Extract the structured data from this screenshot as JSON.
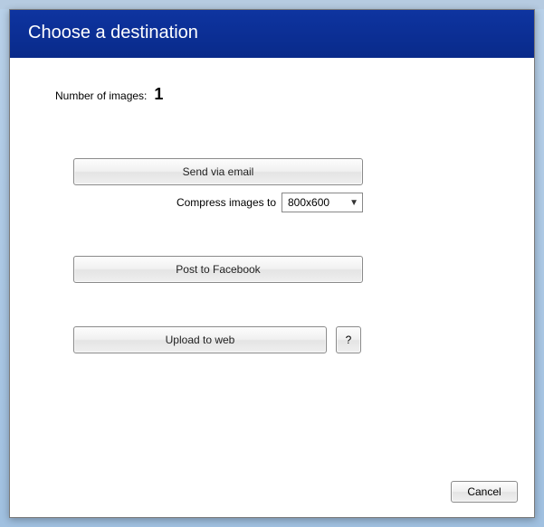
{
  "header": {
    "title": "Choose a destination"
  },
  "count": {
    "label": "Number of images:",
    "value": "1"
  },
  "actions": {
    "email_label": "Send via email",
    "compress_label": "Compress images to",
    "compress_value": "800x600",
    "facebook_label": "Post to Facebook",
    "upload_label": "Upload to web",
    "help_label": "?"
  },
  "footer": {
    "cancel_label": "Cancel"
  }
}
